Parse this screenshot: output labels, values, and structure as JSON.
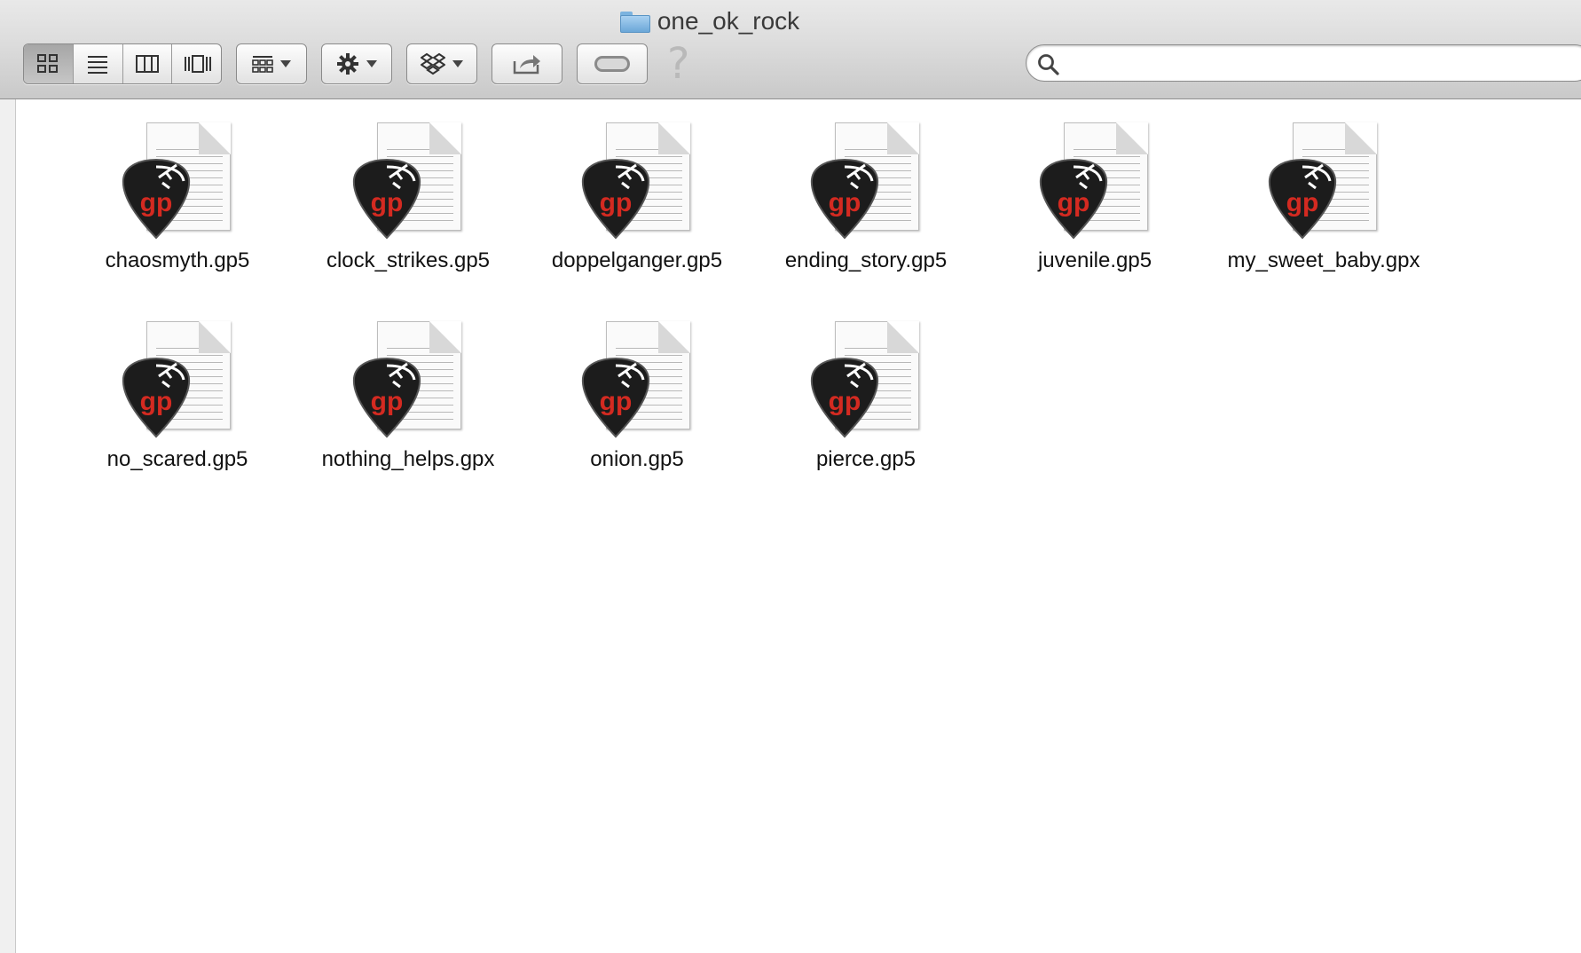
{
  "window": {
    "title": "one_ok_rock"
  },
  "toolbar": {
    "view_modes": [
      {
        "name": "icon-view",
        "icon": "grid-icon",
        "active": true
      },
      {
        "name": "list-view",
        "icon": "list-icon",
        "active": false
      },
      {
        "name": "column-view",
        "icon": "columns-icon",
        "active": false
      },
      {
        "name": "coverflow-view",
        "icon": "coverflow-icon",
        "active": false
      }
    ],
    "arrange_icon": "arrange-grid-icon",
    "action_icon": "gear-icon",
    "dropbox_icon": "dropbox-icon",
    "share_icon": "share-icon",
    "tags_icon": "tag-toggle-icon",
    "help_symbol": "?"
  },
  "search": {
    "placeholder": "",
    "value": ""
  },
  "files": [
    {
      "name": "chaosmyth.gp5"
    },
    {
      "name": "clock_strikes.gp5"
    },
    {
      "name": "doppelganger.gp5"
    },
    {
      "name": "ending_story.gp5"
    },
    {
      "name": "juvenile.gp5"
    },
    {
      "name": "my_sweet_baby.gpx"
    },
    {
      "name": "no_scared.gp5"
    },
    {
      "name": "nothing_helps.gpx"
    },
    {
      "name": "onion.gp5"
    },
    {
      "name": "pierce.gp5"
    }
  ],
  "icon_badge_text": "gp",
  "colors": {
    "pick_dark": "#1c1c1c",
    "gp_red": "#d42a21"
  }
}
